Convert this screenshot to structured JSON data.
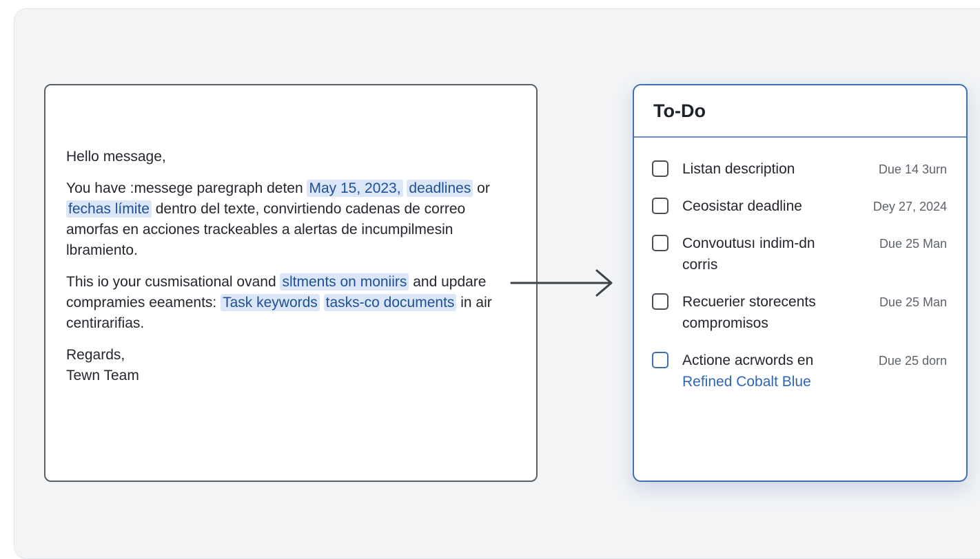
{
  "email": {
    "greeting": "Hello message,",
    "p1_part1": "You have :messege paregraph deten ",
    "p1_hl1": "May 15, 2023,",
    "p1_hl2": "deadlines",
    "p1_part2": " or ",
    "p1_hl3": "fechas límite",
    "p1_part3": " dentro del texte, convirtiendo cadenas de correo amorfas en acciones trackeables a alertas de incumpilmesin lbramiento.",
    "p2_part1": "This io your cusmisational ovand ",
    "p2_hl1": "sltments on moniirs",
    "p2_part2": " and updare compramies eeaments: ",
    "p2_hl2": "Task keywords",
    "p2_hl3": "tasks-co documents",
    "p2_part3": " in air centirarifias.",
    "signoff": "Regards,",
    "signature": "Tewn Team"
  },
  "todo": {
    "title": "To-Do",
    "items": [
      {
        "text": "Listan description",
        "link": "",
        "due": "Due 14 3urn",
        "checked": false
      },
      {
        "text": "Ceosistar deadline",
        "link": "",
        "due": "Dey 27, 2024",
        "checked": false
      },
      {
        "text": "Convoutusı indim-dn corris",
        "link": "",
        "due": "Due 25 Man",
        "checked": false
      },
      {
        "text": "Recuerier storecents compromisos",
        "link": "",
        "due": "Due 25 Man",
        "checked": false
      },
      {
        "text": "Actione acrwords en",
        "link": "Refined Cobalt Blue",
        "due": "Due 25 dorn",
        "checked": false
      }
    ]
  },
  "colors": {
    "accent": "#2f65b3",
    "highlight_bg": "#dbe7f6",
    "card_border": "#5a5f66",
    "todo_border": "#3f6fb5"
  },
  "icons": {
    "flow_arrow": "right-arrow-icon",
    "checkbox": "checkbox-unchecked-icon"
  }
}
